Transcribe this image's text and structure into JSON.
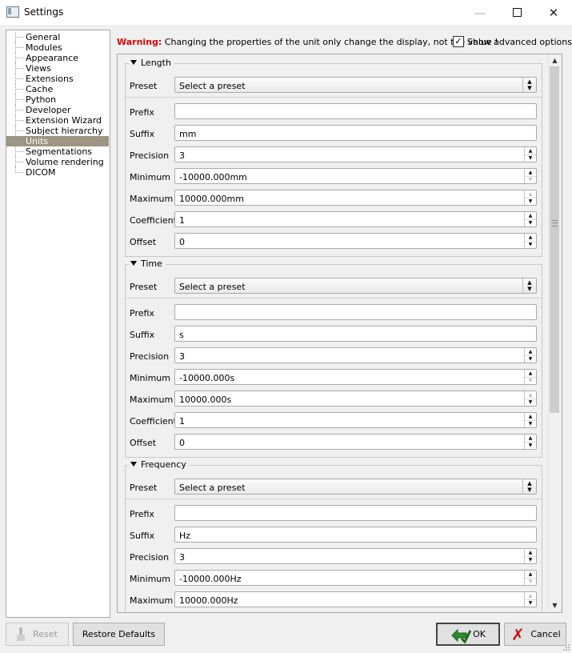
{
  "window": {
    "title": "Settings",
    "minimize": "—",
    "close": "✕"
  },
  "sidebar": {
    "items": [
      "General",
      "Modules",
      "Appearance",
      "Views",
      "Extensions",
      "Cache",
      "Python",
      "Developer",
      "Extension Wizard",
      "Subject hierarchy",
      "Units",
      "Segmentations",
      "Volume rendering",
      "DICOM"
    ],
    "selected": "Units"
  },
  "header": {
    "warning_label": "Warning:",
    "warning_text": " Changing the properties of the unit only change the display, not the value !",
    "advanced_checked": true,
    "advanced_label": "Show advanced options"
  },
  "labels": {
    "preset": "Preset",
    "prefix": "Prefix",
    "suffix": "Suffix",
    "precision": "Precision",
    "minimum": "Minimum",
    "maximum": "Maximum",
    "coefficient": "Coefficient",
    "offset": "Offset"
  },
  "groups": [
    {
      "title": "Length",
      "preset": "Select a preset",
      "prefix": "",
      "suffix": "mm",
      "precision": "3",
      "minimum": "-10000.000mm",
      "maximum": "10000.000mm",
      "coefficient": "1",
      "offset": "0"
    },
    {
      "title": "Time",
      "preset": "Select a preset",
      "prefix": "",
      "suffix": "s",
      "precision": "3",
      "minimum": "-10000.000s",
      "maximum": "10000.000s",
      "coefficient": "1",
      "offset": "0"
    },
    {
      "title": "Frequency",
      "preset": "Select a preset",
      "prefix": "",
      "suffix": "Hz",
      "precision": "3",
      "minimum": "-10000.000Hz",
      "maximum": "10000.000Hz"
    }
  ],
  "buttons": {
    "reset": "Reset",
    "restore": "Restore Defaults",
    "ok": "OK",
    "cancel": "Cancel"
  }
}
